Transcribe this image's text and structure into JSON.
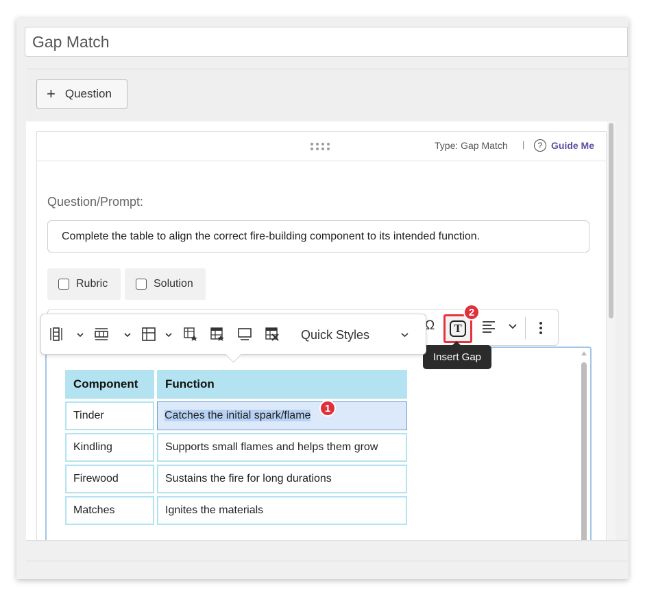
{
  "editor": {
    "title_value": "Gap Match",
    "add_question_label": "Question",
    "card": {
      "type_label": "Type: Gap Match",
      "separator": "|",
      "guide_me_label": "Guide Me",
      "help_glyph": "?"
    },
    "prompt_label": "Question/Prompt:",
    "prompt_text": "Complete the table to align the correct fire-building component to its intended function.",
    "rubric_label": "Rubric",
    "solution_label": "Solution"
  },
  "rich_toolbar": {
    "special_char_glyph": "Ω",
    "insert_gap_glyph": "T",
    "insert_gap_tooltip": "Insert Gap"
  },
  "table_toolbar": {
    "quick_styles_label": "Quick Styles"
  },
  "table": {
    "headers": [
      "Component",
      "Function"
    ],
    "rows": [
      [
        "Tinder",
        "Catches the initial spark/flame"
      ],
      [
        "Kindling",
        "Supports small flames and helps them grow"
      ],
      [
        "Firewood",
        "Sustains the fire for long durations"
      ],
      [
        "Matches",
        "Ignites the materials"
      ]
    ]
  },
  "callouts": {
    "step1": "1",
    "step2": "2"
  },
  "colors": {
    "accent_red": "#e8323c",
    "guide_purple": "#5b4fa3",
    "table_header": "#b3e3f0",
    "selection": "#b7d1f3"
  }
}
